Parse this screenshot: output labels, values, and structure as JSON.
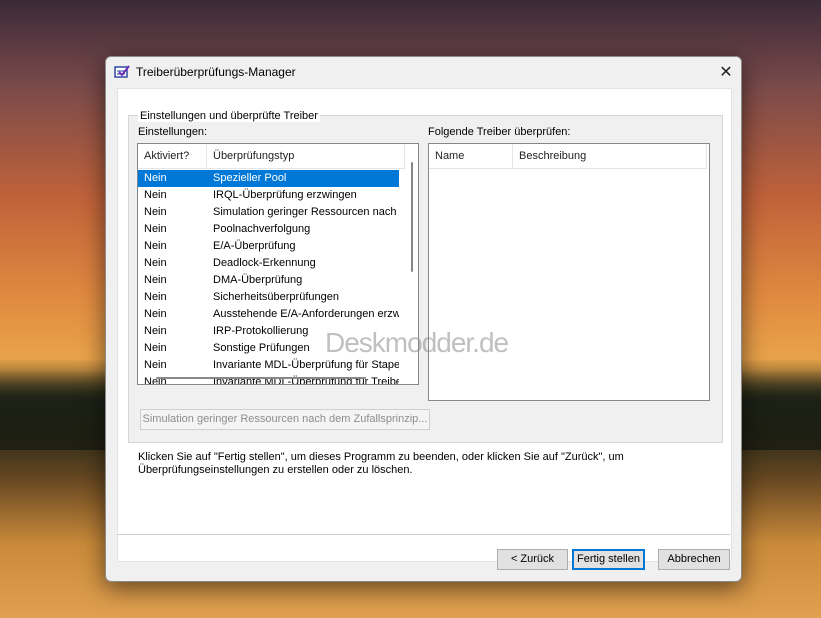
{
  "window": {
    "title": "Treiberüberprüfungs-Manager"
  },
  "group": {
    "title": "Einstellungen und überprüfte Treiber"
  },
  "left": {
    "label": "Einstellungen:",
    "columns": [
      "Aktiviert?",
      "Überprüfungstyp"
    ],
    "rows": [
      {
        "enabled": "Nein",
        "type": "Spezieller Pool"
      },
      {
        "enabled": "Nein",
        "type": "IRQL-Überprüfung erzwingen"
      },
      {
        "enabled": "Nein",
        "type": "Simulation geringer Ressourcen nach d"
      },
      {
        "enabled": "Nein",
        "type": "Poolnachverfolgung"
      },
      {
        "enabled": "Nein",
        "type": "E/A-Überprüfung"
      },
      {
        "enabled": "Nein",
        "type": "Deadlock-Erkennung"
      },
      {
        "enabled": "Nein",
        "type": "DMA-Überprüfung"
      },
      {
        "enabled": "Nein",
        "type": "Sicherheitsüberprüfungen"
      },
      {
        "enabled": "Nein",
        "type": "Ausstehende E/A-Anforderungen erzwi."
      },
      {
        "enabled": "Nein",
        "type": "IRP-Protokollierung"
      },
      {
        "enabled": "Nein",
        "type": "Sonstige Prüfungen"
      },
      {
        "enabled": "Nein",
        "type": "Invariante MDL-Überprüfung für Stapel"
      },
      {
        "enabled": "Nein",
        "type": "Invariante MDL-Überprüfung für Treiber"
      }
    ]
  },
  "right": {
    "label": "Folgende Treiber überprüfen:",
    "columns": [
      "Name",
      "Beschreibung"
    ]
  },
  "sim_button": "Simulation geringer Ressourcen nach dem Zufallsprinzip...",
  "info_line1": "Klicken Sie auf \"Fertig stellen\", um dieses Programm zu beenden, oder klicken Sie auf \"Zurück\", um",
  "info_line2": "Überprüfungseinstellungen zu erstellen oder zu löschen.",
  "buttons": {
    "back": "< Zurück",
    "finish": "Fertig stellen",
    "cancel": "Abbrechen"
  },
  "watermark": "Deskmodder.de",
  "colors": {
    "selection": "#0078d7",
    "dialog_bg": "#f0f0f0"
  },
  "icons": {
    "title": "checklist-icon",
    "close": "close-icon"
  }
}
